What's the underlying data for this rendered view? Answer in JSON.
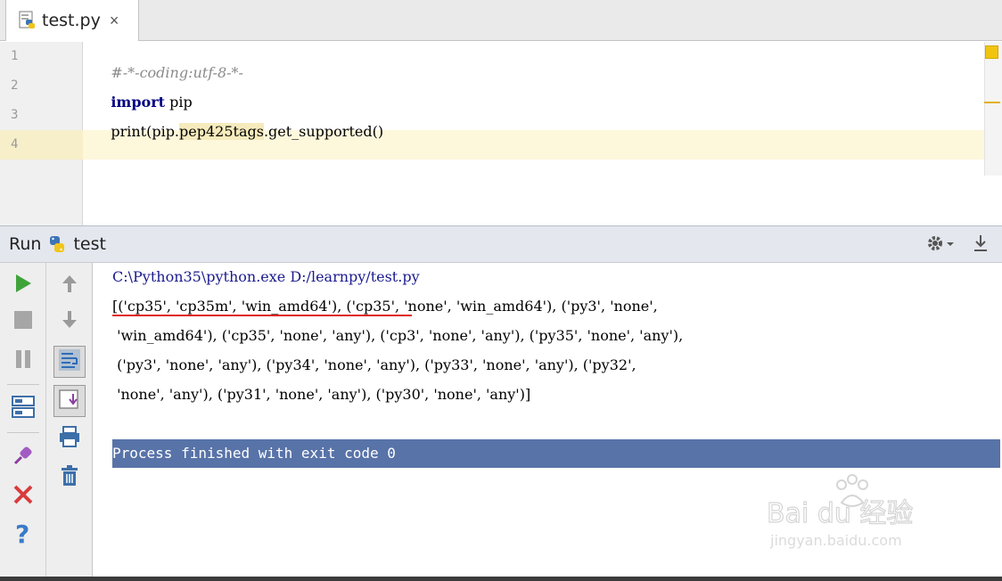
{
  "tab": {
    "filename": "test.py",
    "close": "×"
  },
  "editor": {
    "lines": [
      {
        "no": "1",
        "comment": "#-*-coding:utf-8-*-"
      },
      {
        "no": "2",
        "keyword": "import",
        "rest": " pip"
      },
      {
        "no": "3",
        "pre": "print(pip.",
        "highlight": "pep425tags",
        "post": ".get_supported()"
      },
      {
        "no": "4"
      }
    ]
  },
  "run": {
    "title": "Run",
    "config": "test",
    "console": {
      "command": "C:\\Python35\\python.exe D:/learnpy/test.py",
      "output_lines": [
        "[('cp35', 'cp35m', 'win_amd64'), ('cp35', 'none', 'win_amd64'), ('py3', 'none',",
        " 'win_amd64'), ('cp35', 'none', 'any'), ('cp3', 'none', 'any'), ('py35', 'none', 'any'),",
        " ('py3', 'none', 'any'), ('py34', 'none', 'any'), ('py33', 'none', 'any'), ('py32',",
        " 'none', 'any'), ('py31', 'none', 'any'), ('py30', 'none', 'any')]"
      ],
      "finished": "Process finished with exit code 0"
    }
  },
  "watermark": {
    "brand": "Bai du 经验",
    "url": "jingyan.baidu.com"
  }
}
